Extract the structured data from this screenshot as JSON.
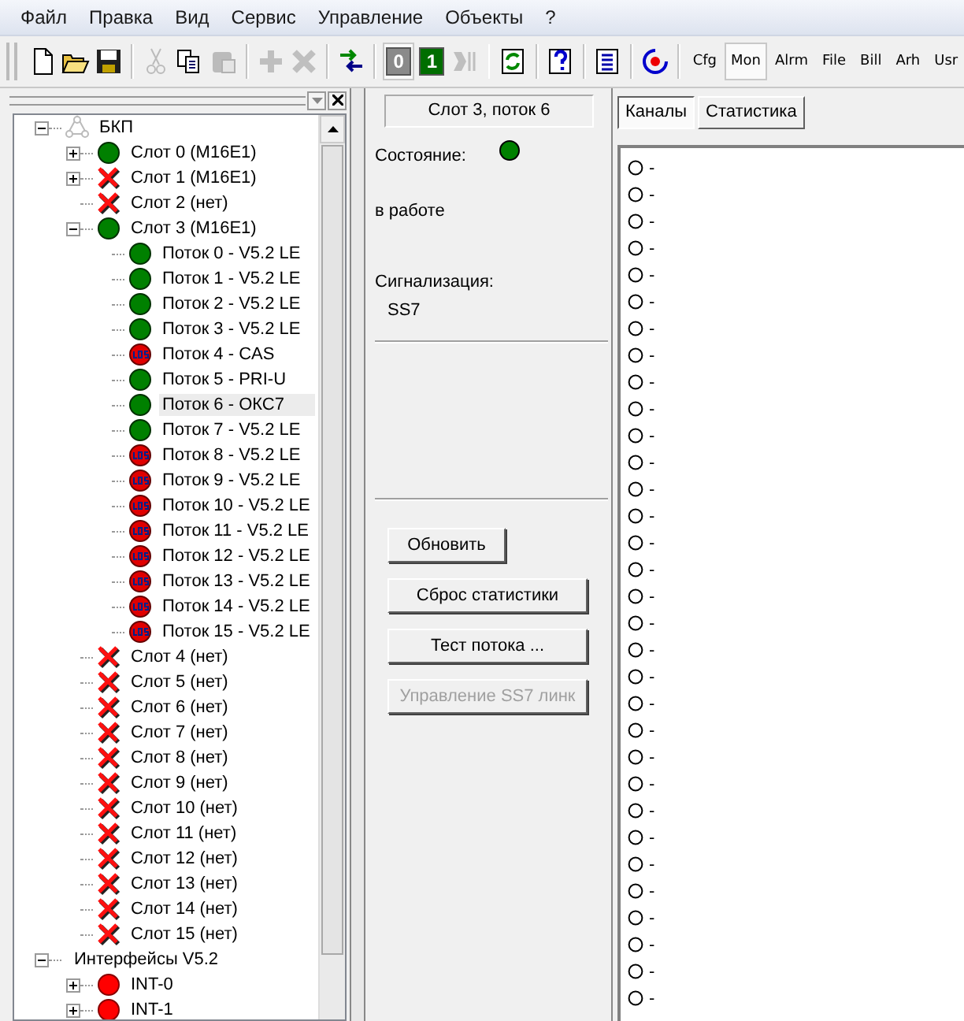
{
  "menu": [
    "Файл",
    "Правка",
    "Вид",
    "Сервис",
    "Управление",
    "Объекты",
    "?"
  ],
  "toolbar": {
    "icon_buttons": [
      {
        "disabled": false
      },
      {
        "disabled": false
      },
      {
        "disabled": false
      },
      {
        "disabled": true
      },
      {
        "disabled": false
      },
      {
        "disabled": true
      },
      {
        "disabled": true
      },
      {
        "disabled": true
      },
      {
        "disabled": false
      }
    ],
    "digit_buttons": [
      {
        "label": "0",
        "selected": true
      },
      {
        "label": "1",
        "selected": false
      }
    ],
    "tail_buttons": [
      {
        "disabled": true
      },
      {
        "disabled": false
      },
      {
        "disabled": false
      },
      {
        "disabled": false
      },
      {
        "disabled": false
      }
    ],
    "modes": [
      {
        "label": "Cfg",
        "selected": false
      },
      {
        "label": "Mon",
        "selected": true
      },
      {
        "label": "Alrm",
        "selected": false
      },
      {
        "label": "File",
        "selected": false
      },
      {
        "label": "Bill",
        "selected": false
      },
      {
        "label": "Arh",
        "selected": false
      },
      {
        "label": "Usr",
        "selected": false
      }
    ]
  },
  "tree": [
    {
      "label": "БКП",
      "kind": "root",
      "expanded": true,
      "selected": false,
      "children": [
        {
          "label": "Слот 0 (M16E1)",
          "kind": "ok",
          "expanded": false,
          "selected": false
        },
        {
          "label": "Слот 1 (M16E1)",
          "kind": "absent",
          "expanded": false,
          "selected": false
        },
        {
          "label": "Слот 2 (нет)",
          "kind": "absent",
          "selected": false
        },
        {
          "label": "Слот 3 (M16E1)",
          "kind": "ok",
          "expanded": true,
          "selected": false,
          "children": [
            {
              "label": "Поток 0 - V5.2 LE",
              "kind": "ok",
              "selected": false
            },
            {
              "label": "Поток 1 - V5.2 LE",
              "kind": "ok",
              "selected": false
            },
            {
              "label": "Поток 2 - V5.2 LE",
              "kind": "ok",
              "selected": false
            },
            {
              "label": "Поток 3 - V5.2 LE",
              "kind": "ok",
              "selected": false
            },
            {
              "label": "Поток 4 - CAS",
              "kind": "los",
              "selected": false
            },
            {
              "label": "Поток 5 - PRI-U",
              "kind": "ok",
              "selected": false
            },
            {
              "label": "Поток 6 - ОКС7",
              "kind": "ok",
              "selected": true
            },
            {
              "label": "Поток 7 - V5.2 LE",
              "kind": "ok",
              "selected": false
            },
            {
              "label": "Поток 8 - V5.2 LE",
              "kind": "los",
              "selected": false
            },
            {
              "label": "Поток 9 - V5.2 LE",
              "kind": "los",
              "selected": false
            },
            {
              "label": "Поток 10 - V5.2 LE",
              "kind": "los",
              "selected": false
            },
            {
              "label": "Поток 11 - V5.2 LE",
              "kind": "los",
              "selected": false
            },
            {
              "label": "Поток 12 - V5.2 LE",
              "kind": "los",
              "selected": false
            },
            {
              "label": "Поток 13 - V5.2 LE",
              "kind": "los",
              "selected": false
            },
            {
              "label": "Поток 14 - V5.2 LE",
              "kind": "los",
              "selected": false
            },
            {
              "label": "Поток 15 - V5.2 LE",
              "kind": "los",
              "selected": false
            }
          ]
        },
        {
          "label": "Слот 4 (нет)",
          "kind": "absent",
          "selected": false
        },
        {
          "label": "Слот 5 (нет)",
          "kind": "absent",
          "selected": false
        },
        {
          "label": "Слот 6 (нет)",
          "kind": "absent",
          "selected": false
        },
        {
          "label": "Слот 7 (нет)",
          "kind": "absent",
          "selected": false
        },
        {
          "label": "Слот 8 (нет)",
          "kind": "absent",
          "selected": false
        },
        {
          "label": "Слот 9 (нет)",
          "kind": "absent",
          "selected": false
        },
        {
          "label": "Слот 10 (нет)",
          "kind": "absent",
          "selected": false
        },
        {
          "label": "Слот 11 (нет)",
          "kind": "absent",
          "selected": false
        },
        {
          "label": "Слот 12 (нет)",
          "kind": "absent",
          "selected": false
        },
        {
          "label": "Слот 13 (нет)",
          "kind": "absent",
          "selected": false
        },
        {
          "label": "Слот 14 (нет)",
          "kind": "absent",
          "selected": false
        },
        {
          "label": "Слот 15 (нет)",
          "kind": "absent",
          "selected": false
        }
      ]
    },
    {
      "label": "Интерфейсы V5.2",
      "expanded": true,
      "selected": false,
      "children": [
        {
          "label": "INT-0",
          "kind": "red",
          "expanded": false,
          "selected": false
        },
        {
          "label": "INT-1",
          "kind": "red",
          "expanded": false,
          "selected": false
        }
      ]
    }
  ],
  "info": {
    "title": "Слот 3, поток 6",
    "state_label": "Состояние:",
    "state_dot": {
      "color": "#008000"
    },
    "state_text": "в работе",
    "signaling_label": "Сигнализация:",
    "signaling_value": "SS7",
    "buttons": [
      {
        "label": "Обновить",
        "disabled": false
      },
      {
        "label": "Сброс статистики",
        "disabled": false
      },
      {
        "label": "Тест потока ...",
        "disabled": false
      },
      {
        "label": "Управление SS7 линк",
        "disabled": true
      }
    ]
  },
  "tabs": [
    {
      "label": "Каналы",
      "selected": true
    },
    {
      "label": "Статистика",
      "selected": false
    }
  ],
  "channels": [
    {
      "label": "-"
    },
    {
      "label": "-"
    },
    {
      "label": "-"
    },
    {
      "label": "-"
    },
    {
      "label": "-"
    },
    {
      "label": "-"
    },
    {
      "label": "-"
    },
    {
      "label": "-"
    },
    {
      "label": "-"
    },
    {
      "label": "-"
    },
    {
      "label": "-"
    },
    {
      "label": "-"
    },
    {
      "label": "-"
    },
    {
      "label": "-"
    },
    {
      "label": "-"
    },
    {
      "label": "-"
    },
    {
      "label": "-"
    },
    {
      "label": "-"
    },
    {
      "label": "-"
    },
    {
      "label": "-"
    },
    {
      "label": "-"
    },
    {
      "label": "-"
    },
    {
      "label": "-"
    },
    {
      "label": "-"
    },
    {
      "label": "-"
    },
    {
      "label": "-"
    },
    {
      "label": "-"
    },
    {
      "label": "-"
    },
    {
      "label": "-"
    },
    {
      "label": "-"
    },
    {
      "label": "-"
    },
    {
      "label": "-"
    }
  ]
}
